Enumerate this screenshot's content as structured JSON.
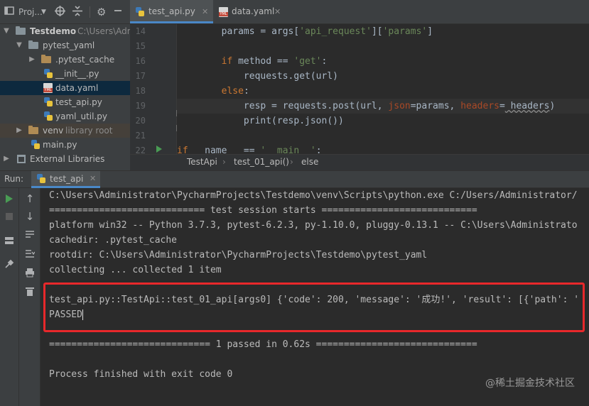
{
  "project_toolbar": {
    "project_label": "Proj...",
    "dropdown_icon": "chevron-down-icon",
    "icons": [
      "target-icon",
      "collapse-icon",
      "gear-icon",
      "minimize-icon"
    ]
  },
  "project_tree": {
    "items": [
      {
        "label": "Testdemo",
        "hint": "C:\\Users\\Adm",
        "kind": "root-folder"
      },
      {
        "label": "pytest_yaml",
        "kind": "folder"
      },
      {
        "label": ".pytest_cache",
        "kind": "folder"
      },
      {
        "label": "__init__.py",
        "kind": "py"
      },
      {
        "label": "data.yaml",
        "kind": "yaml"
      },
      {
        "label": "test_api.py",
        "kind": "py"
      },
      {
        "label": "yaml_util.py",
        "kind": "py"
      },
      {
        "label": "venv",
        "hint": "library root",
        "kind": "folder"
      },
      {
        "label": "main.py",
        "kind": "py"
      },
      {
        "label": "External Libraries",
        "kind": "library"
      }
    ]
  },
  "editor_tabs": [
    {
      "label": "test_api.py",
      "active": true
    },
    {
      "label": "data.yaml",
      "active": false
    }
  ],
  "editor": {
    "line_numbers": [
      "14",
      "15",
      "16",
      "17",
      "18",
      "19",
      "20",
      "21",
      "22"
    ],
    "lines": [
      {
        "indent": "        ",
        "parts": [
          [
            "params = args[",
            "t"
          ],
          [
            "'api_request'",
            "s"
          ],
          [
            "][",
            "t"
          ],
          [
            "'params'",
            "s"
          ],
          [
            "]",
            "t"
          ]
        ]
      },
      {
        "indent": "",
        "parts": []
      },
      {
        "indent": "        ",
        "parts": [
          [
            "if",
            "k"
          ],
          [
            " method == ",
            "t"
          ],
          [
            "'get'",
            "s"
          ],
          [
            ":",
            "t"
          ]
        ]
      },
      {
        "indent": "            ",
        "parts": [
          [
            "requests.get(url)",
            "t"
          ]
        ]
      },
      {
        "indent": "        ",
        "parts": [
          [
            "else",
            "k"
          ],
          [
            ":",
            "t"
          ]
        ]
      },
      {
        "indent": "            ",
        "parts": [
          [
            "resp = requests.post(url, ",
            "t"
          ],
          [
            "json",
            "p"
          ],
          [
            "=params, ",
            "t"
          ],
          [
            "headers",
            "p"
          ],
          [
            "=",
            "t"
          ],
          [
            " headers",
            "u"
          ],
          [
            ")",
            "t"
          ]
        ]
      },
      {
        "indent": "            ",
        "parts": [
          [
            "print(resp.json())",
            "t"
          ]
        ]
      },
      {
        "indent": "",
        "parts": []
      },
      {
        "indent": "",
        "parts": [
          [
            "if",
            "k"
          ],
          [
            " __name__ == ",
            "t"
          ],
          [
            "'__main__'",
            "s"
          ],
          [
            ":",
            "t"
          ]
        ]
      }
    ]
  },
  "breadcrumb": [
    "TestApi",
    "test_01_api()",
    "else"
  ],
  "run_window": {
    "label": "Run:",
    "tab_label": "test_api",
    "console_lines": [
      "C:\\Users\\Administrator\\PycharmProjects\\Testdemo\\venv\\Scripts\\python.exe C:/Users/Administrator/",
      "============================ test session starts ============================",
      "platform win32 -- Python 3.7.3, pytest-6.2.3, py-1.10.0, pluggy-0.13.1 -- C:\\Users\\Administrato",
      "cachedir: .pytest_cache",
      "rootdir: C:\\Users\\Administrator\\PycharmProjects\\Testdemo\\pytest_yaml",
      "collecting ... collected 1 item",
      "",
      "test_api.py::TestApi::test_01_api[args0] {'code': 200, 'message': '成功!', 'result': [{'path': '",
      "PASSED",
      "",
      "============================= 1 passed in 0.62s =============================",
      "",
      "Process finished with exit code 0"
    ]
  },
  "watermark": "@稀土掘金技术社区",
  "colors": {
    "accent": "#4a88c7",
    "highlight_border": "#e8282b",
    "keyword": "#cc7832",
    "string": "#6a8759",
    "param": "#aa4926"
  }
}
